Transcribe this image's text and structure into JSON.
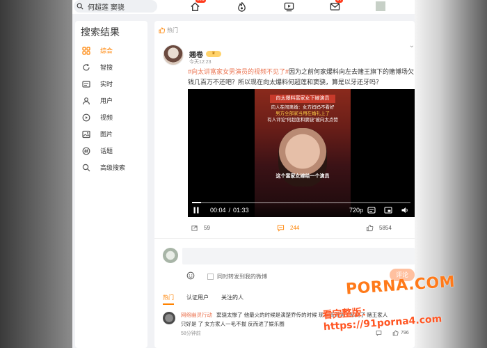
{
  "search": {
    "query": "何超莲 窦骁"
  },
  "nav": {
    "home_badge": "new",
    "mail_badge": "34"
  },
  "sidebar": {
    "title": "搜索结果",
    "items": [
      {
        "label": "综合"
      },
      {
        "label": "智搜"
      },
      {
        "label": "实时"
      },
      {
        "label": "用户"
      },
      {
        "label": "视频"
      },
      {
        "label": "图片"
      },
      {
        "label": "话题"
      },
      {
        "label": "高级搜索"
      }
    ],
    "active_color": "#ff8200"
  },
  "post": {
    "tag": "热门",
    "username": "翘卷",
    "time": "今天12:23",
    "topic": "#向太讲富家女男演员的视频不见了#",
    "text": "因为之前何家爆料向左去赌王旗下的赌博场欠钱几百万不还吧？所以现在向太爆料何超莲和窦骁，算是以牙还牙吗？",
    "video": {
      "headline": "向太爆料富家女下嫁演员",
      "line1": "向人在闹离婚：女方妈妈不看好",
      "line2": "男方全部家当用在婚礼上了",
      "line3": "有人评论“何超莲和窦骁”被向太点赞",
      "caption": "这个富家女嫁给一个演员",
      "current_time": "00:04",
      "duration": "01:33",
      "quality": "720p",
      "progress": 0.04
    },
    "actions": {
      "reposts": "59",
      "comments": "244",
      "likes": "5854"
    }
  },
  "composer": {
    "repost_label": "同时转发到我的微博",
    "submit_label": "评论"
  },
  "comment_tabs": [
    {
      "label": "热门"
    },
    {
      "label": "认证用户"
    },
    {
      "label": "关注的人"
    }
  ],
  "comment": {
    "name": "网络幽灵行动",
    "text": "窦骁太惨了 他最火的时候是演楚乔传的时候 现在搞得两个都离了 赌王家人只好是 了 女方家人一毛不拔 反而进了娱乐圈",
    "time": "58分钟前",
    "likes": "796"
  },
  "watermark": {
    "brand": "PORNA.COM",
    "line2": "看完整版：https://91porna4.com"
  }
}
